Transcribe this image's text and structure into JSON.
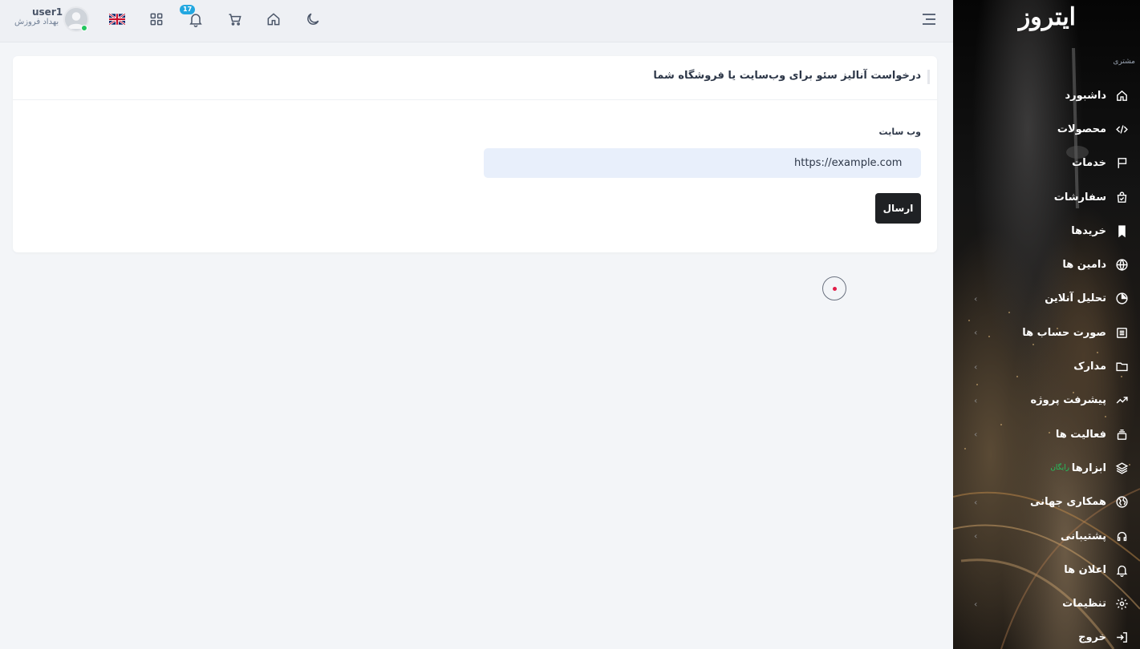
{
  "sidebar": {
    "brand": "ایتروز",
    "role": "مشتری",
    "items": [
      {
        "label": "داشبورد",
        "icon": "home-icon",
        "chevron": false
      },
      {
        "label": "محصولات",
        "icon": "code-icon",
        "chevron": false
      },
      {
        "label": "خدمات",
        "icon": "flag-icon",
        "chevron": false
      },
      {
        "label": "سفارشات",
        "icon": "shopping-bag-icon",
        "chevron": false
      },
      {
        "label": "خریدها",
        "icon": "bookmark-icon",
        "chevron": false
      },
      {
        "label": "دامین ها",
        "icon": "globe-icon",
        "chevron": false
      },
      {
        "label": "تحلیل آنلاین",
        "icon": "pie-chart-icon",
        "chevron": true
      },
      {
        "label": "صورت حساب ها",
        "icon": "invoice-icon",
        "chevron": true
      },
      {
        "label": "مدارک",
        "icon": "folder-icon",
        "chevron": true
      },
      {
        "label": "پیشرفت پروژه",
        "icon": "trending-up-icon",
        "chevron": true
      },
      {
        "label": "فعالیت ها",
        "icon": "stack-icon",
        "chevron": true
      },
      {
        "label": "ابزارها",
        "icon": "layers-icon",
        "chevron": false,
        "badge": "رایگان"
      },
      {
        "label": "همکاری جهانی",
        "icon": "world-icon",
        "chevron": true
      },
      {
        "label": "پشتیبانی",
        "icon": "headset-icon",
        "chevron": true
      },
      {
        "label": "اعلان ها",
        "icon": "bell-icon",
        "chevron": false
      },
      {
        "label": "تنظیمات",
        "icon": "gear-icon",
        "chevron": true
      },
      {
        "label": "خروج",
        "icon": "logout-icon",
        "chevron": false
      }
    ]
  },
  "topbar": {
    "user_name": "user1",
    "user_role": "بهداد فروزش",
    "notification_count": "17",
    "icons": [
      "flag-uk-icon",
      "apps-grid-icon",
      "bell-icon",
      "cart-icon",
      "home-icon",
      "moon-icon",
      "menu-icon"
    ]
  },
  "card": {
    "title": "درخواست آنالیز سئو برای وب‌سایت یا فروشگاه شما",
    "field_label": "وب سایت",
    "input_value": "https://example.com",
    "submit_label": "ارسال"
  },
  "colors": {
    "accent_dark": "#1f2124",
    "input_bg": "#e8effb",
    "online": "#22c55e",
    "badge": "#22a7e0",
    "loader_dot": "#e11d48"
  }
}
